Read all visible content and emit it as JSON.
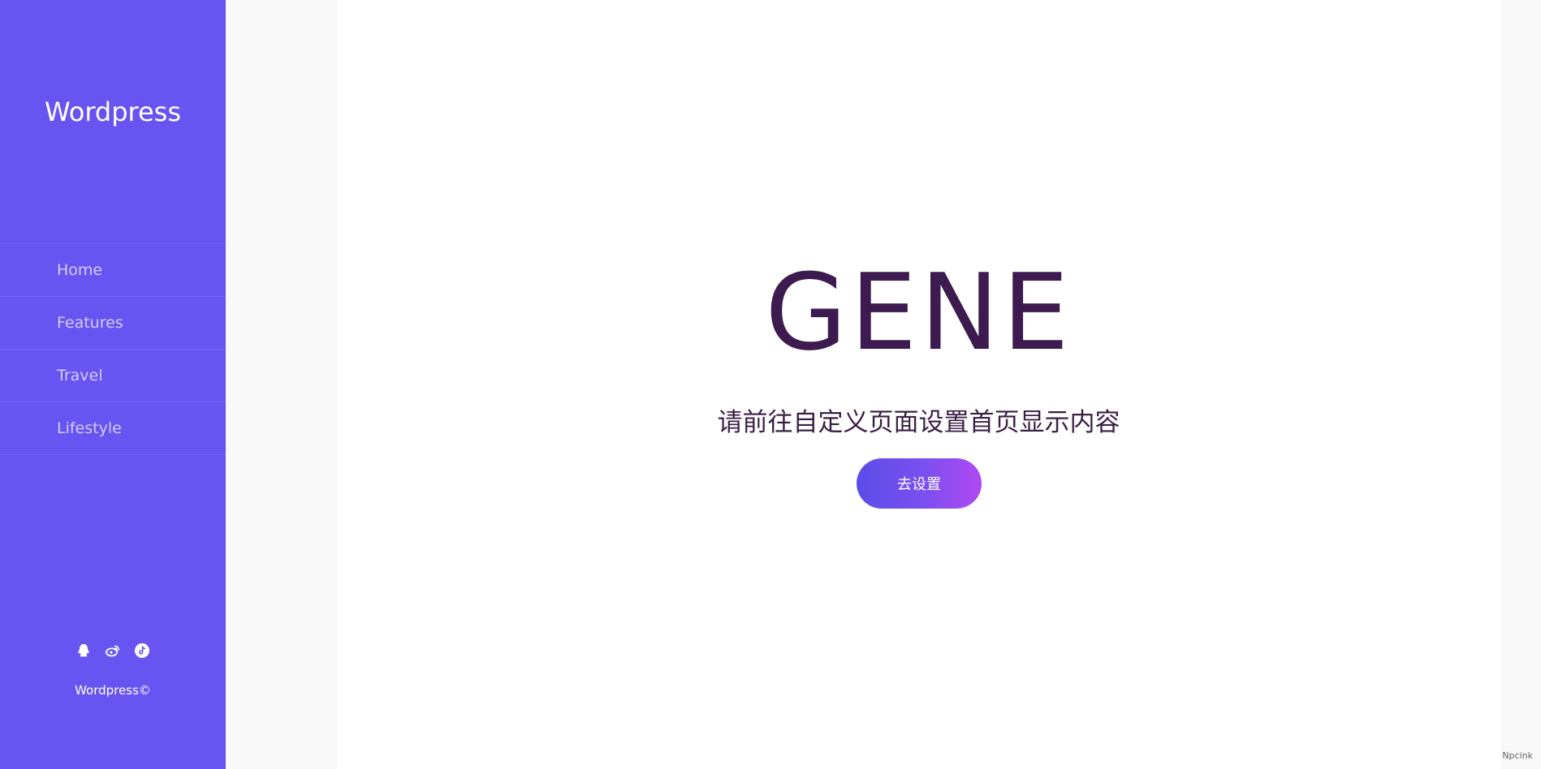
{
  "sidebar": {
    "site_title": "Wordpress",
    "nav": [
      {
        "label": "Home"
      },
      {
        "label": "Features"
      },
      {
        "label": "Travel"
      },
      {
        "label": "Lifestyle"
      }
    ],
    "social_icons": [
      "qq-icon",
      "weibo-icon",
      "tiktok-icon"
    ],
    "copyright": "Wordpress©"
  },
  "main": {
    "hero_title": "GENE",
    "hero_subtitle": "请前往自定义页面设置首页显示内容",
    "cta_label": "去设置"
  },
  "footer": {
    "watermark": "Npcink"
  },
  "colors": {
    "sidebar_bg": "#6854f0",
    "title_color": "#3d1a4f",
    "button_gradient_start": "#5c4de8",
    "button_gradient_end": "#b149f2"
  }
}
